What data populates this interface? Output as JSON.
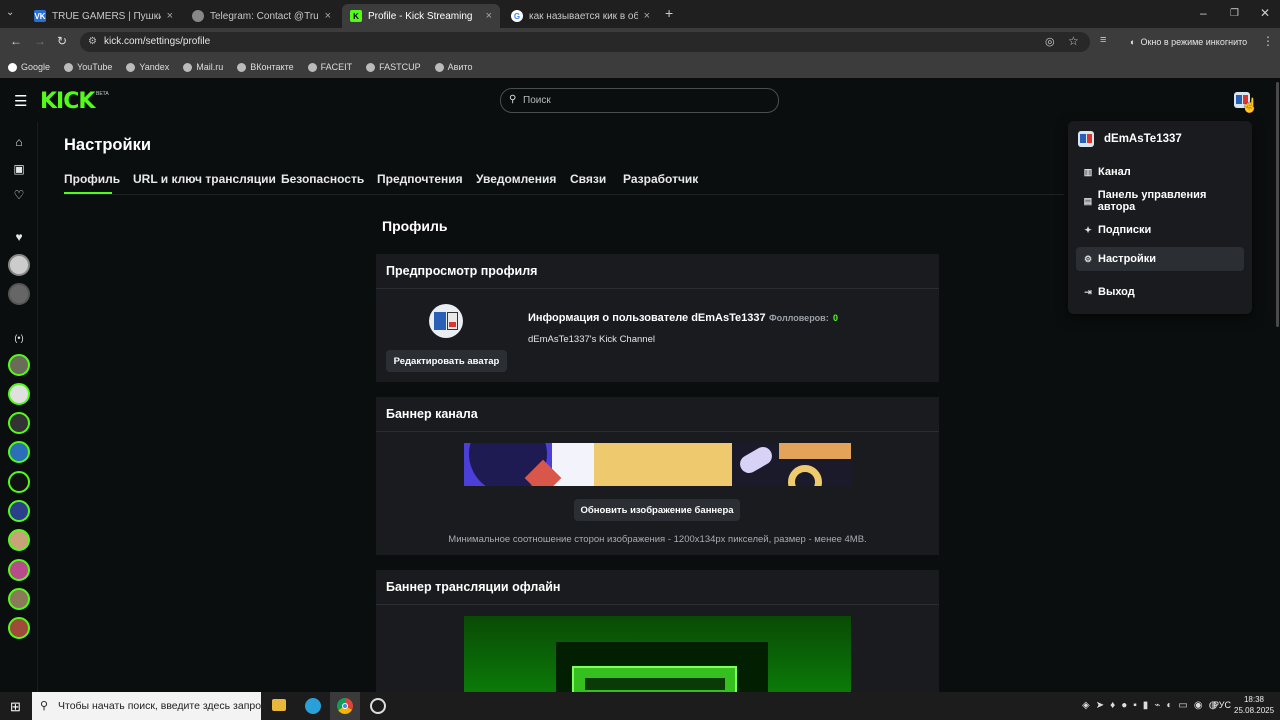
{
  "browser": {
    "tabs": [
      {
        "title": "TRUE GAMERS | Пушкин | Ком",
        "favicon_color": "#2a6fd6",
        "favicon_letter": "VK",
        "active": false
      },
      {
        "title": "Telegram: Contact @TrueGame",
        "favicon_color": "#888888",
        "favicon_letter": "",
        "active": false
      },
      {
        "title": "Profile - Kick Streaming",
        "favicon_color": "#53fc18",
        "favicon_letter": "K",
        "active": true
      },
      {
        "title": "как называется кик в обс - По",
        "favicon_color": "#888888",
        "favicon_letter": "G",
        "active": false
      }
    ],
    "new_tab": "+",
    "url": "kick.com/settings/profile",
    "incognito_label": "Окно в режиме инкогнито",
    "bookmarks": [
      "Google",
      "YouTube",
      "Yandex",
      "Mail.ru",
      "ВКонтакте",
      "FACEIT",
      "FASTCUP",
      "Авито"
    ]
  },
  "kick": {
    "logo": "KICK",
    "logo_badge": "BETA",
    "search_placeholder": "Поиск",
    "page_title": "Настройки",
    "tabs": [
      "Профиль",
      "URL и ключ трансляции",
      "Безопасность",
      "Предпочтения",
      "Уведомления",
      "Связи",
      "Разработчик"
    ],
    "section_title": "Профиль",
    "preview": {
      "title": "Предпросмотр профиля",
      "edit_avatar": "Редактировать аватар",
      "user_info": "Информация о пользователе dEmAsTe1337",
      "followers_label": "Фолловеров:",
      "followers_count": "0",
      "channel_name": "dEmAsTe1337's Kick Channel"
    },
    "banner": {
      "title": "Баннер канала",
      "update_button": "Обновить изображение баннера",
      "hint": "Минимальное соотношение сторон изображения - 1200x134px пикселей, размер - менее 4MB."
    },
    "offline_banner": {
      "title": "Баннер трансляции офлайн"
    },
    "dropdown": {
      "username": "dEmAsTe1337",
      "items": [
        {
          "label": "Канал",
          "icon": "channel-icon"
        },
        {
          "label": "Панель управления автора",
          "icon": "dashboard-icon"
        },
        {
          "label": "Подписки",
          "icon": "subscriptions-icon"
        },
        {
          "label": "Настройки",
          "icon": "settings-icon"
        },
        {
          "label": "Выход",
          "icon": "logout-icon"
        }
      ]
    },
    "accent_color": "#53fc18"
  },
  "taskbar": {
    "search_placeholder": "Чтобы начать поиск, введите здесь запрос",
    "language": "РУС",
    "time": "18:38",
    "date": "25.08.2025"
  }
}
